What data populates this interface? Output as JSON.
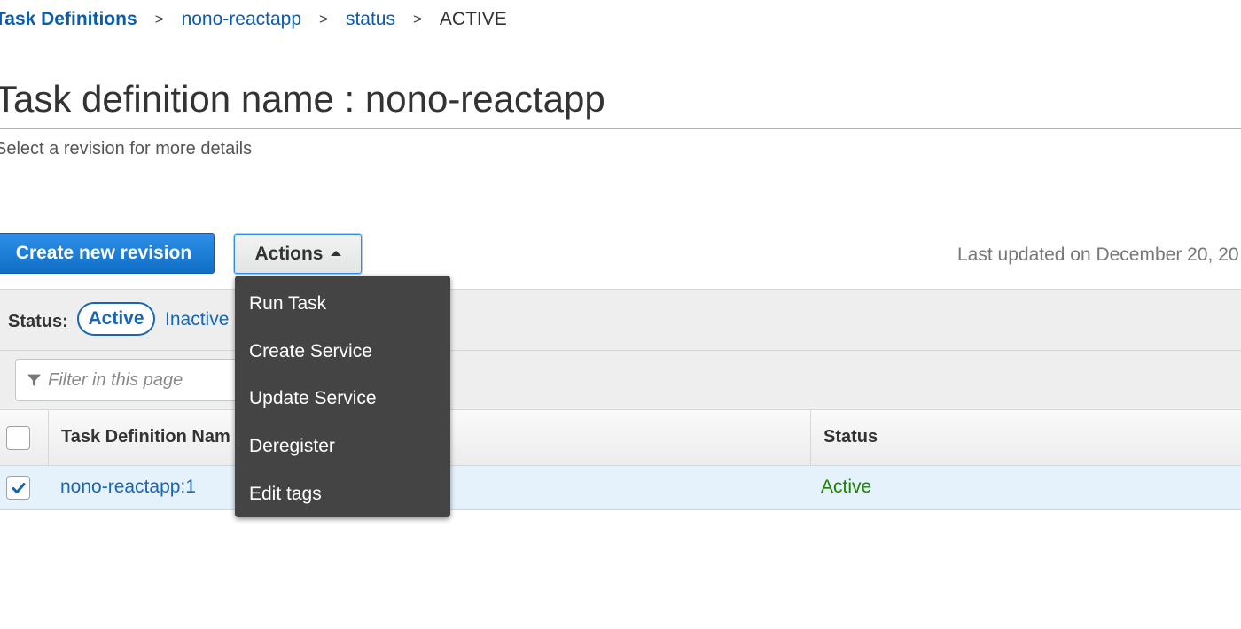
{
  "breadcrumb": {
    "items": [
      "Task Definitions",
      "nono-reactapp",
      "status"
    ],
    "current": "ACTIVE",
    "separator": ">"
  },
  "page": {
    "title": "Task definition name : nono-reactapp",
    "subtitle": "Select a revision for more details"
  },
  "toolbar": {
    "create_label": "Create new revision",
    "actions_label": "Actions",
    "last_updated": "Last updated on December 20, 20"
  },
  "status_filter": {
    "label": "Status:",
    "active_label": "Active",
    "inactive_label": "Inactive"
  },
  "filter": {
    "placeholder": "Filter in this page"
  },
  "table": {
    "columns": [
      "Task Definition Nam",
      "Status"
    ],
    "rows": [
      {
        "name": "nono-reactapp:1",
        "status": "Active",
        "selected": true
      }
    ]
  },
  "actions_menu": {
    "items": [
      "Run Task",
      "Create Service",
      "Update Service",
      "Deregister",
      "Edit tags"
    ]
  },
  "colors": {
    "link": "#1866b4",
    "primary_button": "#106ec4",
    "status_active": "#1d8102",
    "menu_bg": "#444444",
    "selected_row": "#e5f2fc"
  },
  "icons": {
    "filter": "filter-funnel-icon",
    "checkmark": "checkmark-icon",
    "caret": "caret-up-icon"
  }
}
